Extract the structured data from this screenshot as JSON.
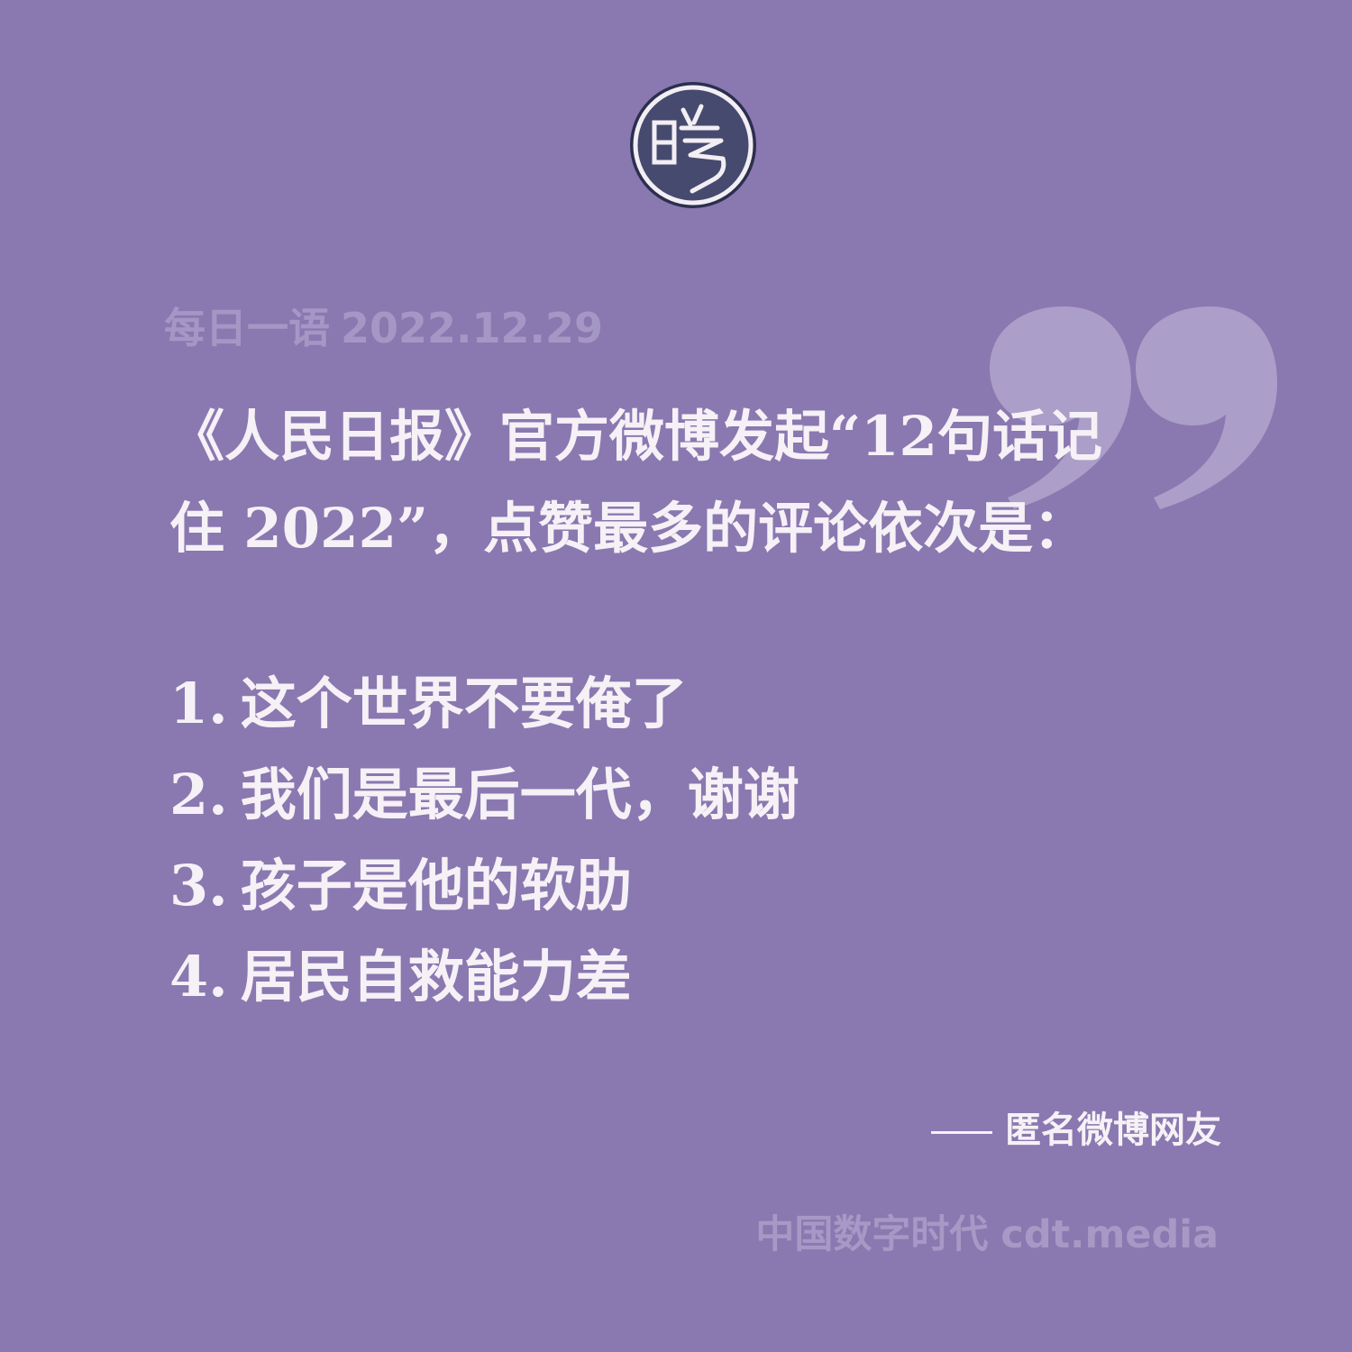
{
  "logo": {
    "icon": "cdt-seal-icon",
    "accent_color": "#454a6e"
  },
  "quote_icon": "closing-quote-icon",
  "header": {
    "label": "每日一语",
    "date": "2022.12.29"
  },
  "intro": {
    "line1": "《人民日报》官方微博发起“12句话记",
    "line2": "住 2022”，点赞最多的评论依次是："
  },
  "comments": [
    {
      "num": "1.",
      "text": "这个世界不要俺了"
    },
    {
      "num": "2.",
      "text": "我们是最后一代，谢谢"
    },
    {
      "num": "3.",
      "text": "孩子是他的软肋"
    },
    {
      "num": "4.",
      "text": "居民自救能力差"
    }
  ],
  "attribution": "匿名微博网友",
  "footer": {
    "brand_cn": "中国数字时代",
    "brand_url": "cdt.media"
  },
  "colors": {
    "background": "#8a78b0",
    "text": "#f5f1f6",
    "muted_text": "#a798c6"
  }
}
